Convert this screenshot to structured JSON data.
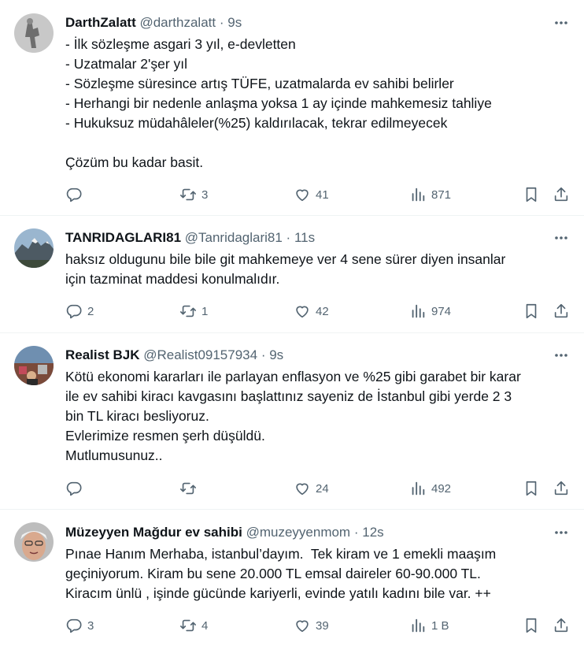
{
  "tweets": [
    {
      "name": "DarthZalatt",
      "handle": "@darthzalatt",
      "sep": "·",
      "time": "9s",
      "lines": [
        "- İlk sözleşme asgari 3 yıl, e-devletten",
        "- Uzatmalar 2'şer yıl",
        "- Sözleşme süresince artış TÜFE, uzatmalarda ev sahibi belirler",
        "- Herhangi bir nedenle anlaşma yoksa 1 ay içinde mahkemesiz tahliye",
        "- Hukuksuz müdahâleler(%25) kaldırılacak, tekrar edilmeyecek",
        "",
        "Çözüm bu kadar basit."
      ],
      "replies": "",
      "retweets": "3",
      "likes": "41",
      "views": "871"
    },
    {
      "name": "TANRIDAGLARI81",
      "handle": "@Tanridaglari81",
      "sep": "·",
      "time": "11s",
      "lines": [
        "haksız oldugunu bile bile git mahkemeye ver 4 sene sürer diyen insanlar",
        "için tazminat maddesi konulmalıdır."
      ],
      "replies": "2",
      "retweets": "1",
      "likes": "42",
      "views": "974"
    },
    {
      "name": "Realist BJK",
      "handle": "@Realist09157934",
      "sep": "·",
      "time": "9s",
      "lines": [
        "Kötü ekonomi kararları ile parlayan enflasyon ve %25 gibi garabet bir karar",
        "ile ev sahibi kiracı kavgasını başlattınız sayeniz de İstanbul gibi yerde 2 3",
        "bin TL kiracı besliyoruz.",
        "Evlerimize resmen şerh düşüldü.",
        "Mutlumusunuz.."
      ],
      "replies": "",
      "retweets": "",
      "likes": "24",
      "views": "492"
    },
    {
      "name": "Müzeyyen Mağdur ev sahibi",
      "handle": "@muzeyyenmom",
      "sep": "·",
      "time": "12s",
      "lines": [
        "Pınae Hanım Merhaba, istanbul’dayım.  Tek kiram ve 1 emekli maaşım",
        "geçiniyorum. Kiram bu sene 20.000 TL emsal daireler 60-90.000 TL.",
        "Kiracım ünlü , işinde gücünde kariyerli, evinde yatılı kadını bile var. ++"
      ],
      "replies": "3",
      "retweets": "4",
      "likes": "39",
      "views": "1 B"
    }
  ],
  "icons": {
    "reply": "reply-icon",
    "retweet": "retweet-icon",
    "like": "like-icon",
    "views": "views-icon",
    "bookmark": "bookmark-icon",
    "share": "share-icon",
    "more": "more-icon"
  },
  "colors": {
    "text": "#0f1419",
    "secondary": "#536471",
    "divider": "#eff3f4"
  }
}
